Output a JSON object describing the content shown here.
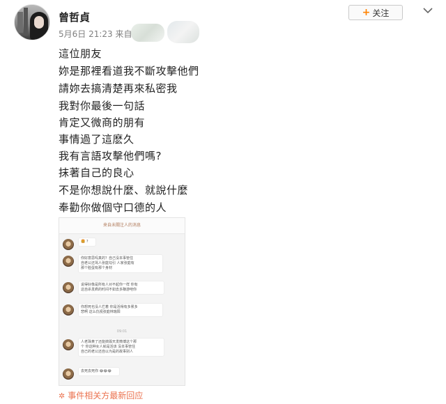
{
  "user": {
    "name": "曾哲貞",
    "meta": "5月6日 21:23 来自"
  },
  "header": {
    "follow_label": "关注",
    "follow_icon": "plus-icon",
    "menu_icon": "chevron-down-icon"
  },
  "post": {
    "lines": [
      "這位朋友",
      "妳是那裡看道我不斷攻擊他們",
      "請妳去搞清楚再來私密我",
      "我對你最後一句話",
      "肯定又微商的朋有",
      "事情過了這麽久",
      "我有言語攻擊他們嗎?",
      "抹著自己的良心",
      "不是你想說什麼、就說什麼",
      "奉勸你做個守口德的人"
    ]
  },
  "screenshot": {
    "title": "来自未關注人的消息",
    "messages": [
      "🍔 ?",
      "你好意思吗真的？自己没本事管住\n自老公还骂人张庭勾引  人家张庭有\n那个脸蛋有那个身材",
      "说得好像是所有人对不起你一样 你有\n这自杀发疯的时间不如去多赚游吧你",
      "你想死也没人拦着 你是活得有多累多\n悲啊 这么仇视张庭林瑞阳",
      "人老珠黄了还能搞毁天发微博这个那\n个 你这种女人就是活该 没本事管住\n自己的老公还自以为是的故事别人",
      "去死去死你 😂😂😂"
    ],
    "time": "09:01"
  },
  "footer": {
    "update_label": "事件相关方最新回应",
    "update_icon": "sparkle-icon"
  },
  "colors": {
    "accent": "#ff8200",
    "link": "#eb7350"
  }
}
